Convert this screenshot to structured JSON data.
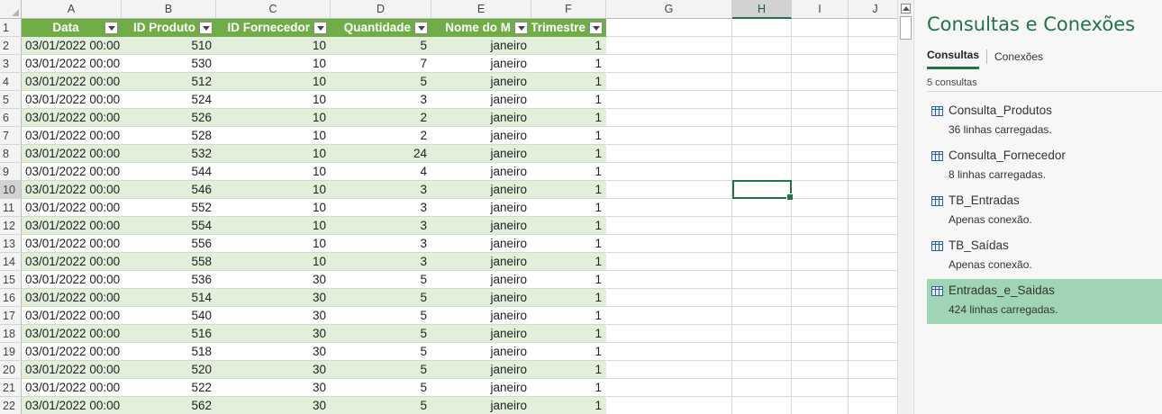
{
  "sheet": {
    "columns": [
      "A",
      "B",
      "C",
      "D",
      "E",
      "F",
      "G",
      "H",
      "I",
      "J"
    ],
    "selected_column": "H",
    "selected_row": 10,
    "table_headers": [
      "Data",
      "ID Produto",
      "ID Fornecedor",
      "Quantidade",
      "Nome do M",
      "Trimestre"
    ],
    "rows": [
      {
        "n": "2",
        "data": "03/01/2022 00:00",
        "id_produto": "510",
        "id_fornecedor": "10",
        "quantidade": "5",
        "mes": "janeiro",
        "trimestre": "1"
      },
      {
        "n": "3",
        "data": "03/01/2022 00:00",
        "id_produto": "530",
        "id_fornecedor": "10",
        "quantidade": "7",
        "mes": "janeiro",
        "trimestre": "1"
      },
      {
        "n": "4",
        "data": "03/01/2022 00:00",
        "id_produto": "512",
        "id_fornecedor": "10",
        "quantidade": "5",
        "mes": "janeiro",
        "trimestre": "1"
      },
      {
        "n": "5",
        "data": "03/01/2022 00:00",
        "id_produto": "524",
        "id_fornecedor": "10",
        "quantidade": "3",
        "mes": "janeiro",
        "trimestre": "1"
      },
      {
        "n": "6",
        "data": "03/01/2022 00:00",
        "id_produto": "526",
        "id_fornecedor": "10",
        "quantidade": "2",
        "mes": "janeiro",
        "trimestre": "1"
      },
      {
        "n": "7",
        "data": "03/01/2022 00:00",
        "id_produto": "528",
        "id_fornecedor": "10",
        "quantidade": "2",
        "mes": "janeiro",
        "trimestre": "1"
      },
      {
        "n": "8",
        "data": "03/01/2022 00:00",
        "id_produto": "532",
        "id_fornecedor": "10",
        "quantidade": "24",
        "mes": "janeiro",
        "trimestre": "1"
      },
      {
        "n": "9",
        "data": "03/01/2022 00:00",
        "id_produto": "544",
        "id_fornecedor": "10",
        "quantidade": "4",
        "mes": "janeiro",
        "trimestre": "1"
      },
      {
        "n": "10",
        "data": "03/01/2022 00:00",
        "id_produto": "546",
        "id_fornecedor": "10",
        "quantidade": "3",
        "mes": "janeiro",
        "trimestre": "1"
      },
      {
        "n": "11",
        "data": "03/01/2022 00:00",
        "id_produto": "552",
        "id_fornecedor": "10",
        "quantidade": "3",
        "mes": "janeiro",
        "trimestre": "1"
      },
      {
        "n": "12",
        "data": "03/01/2022 00:00",
        "id_produto": "554",
        "id_fornecedor": "10",
        "quantidade": "3",
        "mes": "janeiro",
        "trimestre": "1"
      },
      {
        "n": "13",
        "data": "03/01/2022 00:00",
        "id_produto": "556",
        "id_fornecedor": "10",
        "quantidade": "3",
        "mes": "janeiro",
        "trimestre": "1"
      },
      {
        "n": "14",
        "data": "03/01/2022 00:00",
        "id_produto": "558",
        "id_fornecedor": "10",
        "quantidade": "3",
        "mes": "janeiro",
        "trimestre": "1"
      },
      {
        "n": "15",
        "data": "03/01/2022 00:00",
        "id_produto": "536",
        "id_fornecedor": "30",
        "quantidade": "5",
        "mes": "janeiro",
        "trimestre": "1"
      },
      {
        "n": "16",
        "data": "03/01/2022 00:00",
        "id_produto": "514",
        "id_fornecedor": "30",
        "quantidade": "5",
        "mes": "janeiro",
        "trimestre": "1"
      },
      {
        "n": "17",
        "data": "03/01/2022 00:00",
        "id_produto": "540",
        "id_fornecedor": "30",
        "quantidade": "5",
        "mes": "janeiro",
        "trimestre": "1"
      },
      {
        "n": "18",
        "data": "03/01/2022 00:00",
        "id_produto": "516",
        "id_fornecedor": "30",
        "quantidade": "5",
        "mes": "janeiro",
        "trimestre": "1"
      },
      {
        "n": "19",
        "data": "03/01/2022 00:00",
        "id_produto": "518",
        "id_fornecedor": "30",
        "quantidade": "5",
        "mes": "janeiro",
        "trimestre": "1"
      },
      {
        "n": "20",
        "data": "03/01/2022 00:00",
        "id_produto": "520",
        "id_fornecedor": "30",
        "quantidade": "5",
        "mes": "janeiro",
        "trimestre": "1"
      },
      {
        "n": "21",
        "data": "03/01/2022 00:00",
        "id_produto": "522",
        "id_fornecedor": "30",
        "quantidade": "5",
        "mes": "janeiro",
        "trimestre": "1"
      },
      {
        "n": "22",
        "data": "03/01/2022 00:00",
        "id_produto": "562",
        "id_fornecedor": "30",
        "quantidade": "5",
        "mes": "janeiro",
        "trimestre": "1"
      }
    ]
  },
  "pane": {
    "title": "Consultas e Conexões",
    "tabs": [
      "Consultas",
      "Conexões"
    ],
    "count": "5 consultas",
    "queries": [
      {
        "name": "Consulta_Produtos",
        "status": "36 linhas carregadas."
      },
      {
        "name": "Consulta_Fornecedor",
        "status": "8 linhas carregadas."
      },
      {
        "name": "TB_Entradas",
        "status": "Apenas conexão."
      },
      {
        "name": "TB_Saídas",
        "status": "Apenas conexão."
      },
      {
        "name": "Entradas_e_Saidas",
        "status": "424 linhas carregadas."
      }
    ],
    "selected_query": "Entradas_e_Saidas"
  },
  "colors": {
    "table_header": "#70ad47",
    "band": "#e2efda",
    "accent": "#217346",
    "selected_query": "#9fd5b5"
  },
  "icons": [
    "filter-dropdown-icon",
    "query-table-icon",
    "scroll-up-arrow-icon"
  ]
}
